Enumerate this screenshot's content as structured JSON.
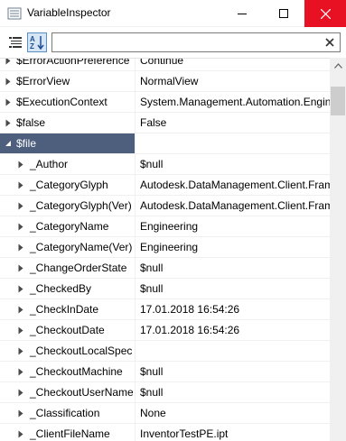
{
  "window": {
    "title": "VariableInspector"
  },
  "toolbar": {
    "categorized_icon": "categorized-icon",
    "alphabetical_icon": "alphabetical-sort-icon",
    "search_value": "",
    "search_placeholder": ""
  },
  "grid": {
    "rows": [
      {
        "name": "$ErrorActionPreference",
        "value": "Continue",
        "level": 0,
        "expanded": false,
        "selected": false
      },
      {
        "name": "$ErrorView",
        "value": "NormalView",
        "level": 0,
        "expanded": false,
        "selected": false
      },
      {
        "name": "$ExecutionContext",
        "value": "System.Management.Automation.EngineIntrinsics",
        "level": 0,
        "expanded": false,
        "selected": false
      },
      {
        "name": "$false",
        "value": "False",
        "level": 0,
        "expanded": false,
        "selected": false
      },
      {
        "name": "$file",
        "value": "",
        "level": 0,
        "expanded": true,
        "selected": true
      },
      {
        "name": "_Author",
        "value": "$null",
        "level": 1,
        "expanded": false,
        "selected": false
      },
      {
        "name": "_CategoryGlyph",
        "value": "Autodesk.DataManagement.Client.Framework",
        "level": 1,
        "expanded": false,
        "selected": false
      },
      {
        "name": "_CategoryGlyph(Ver)",
        "value": "Autodesk.DataManagement.Client.Framework",
        "level": 1,
        "expanded": false,
        "selected": false
      },
      {
        "name": "_CategoryName",
        "value": "Engineering",
        "level": 1,
        "expanded": false,
        "selected": false
      },
      {
        "name": "_CategoryName(Ver)",
        "value": "Engineering",
        "level": 1,
        "expanded": false,
        "selected": false
      },
      {
        "name": "_ChangeOrderState",
        "value": "$null",
        "level": 1,
        "expanded": false,
        "selected": false
      },
      {
        "name": "_CheckedBy",
        "value": "$null",
        "level": 1,
        "expanded": false,
        "selected": false
      },
      {
        "name": "_CheckInDate",
        "value": "17.01.2018 16:54:26",
        "level": 1,
        "expanded": false,
        "selected": false
      },
      {
        "name": "_CheckoutDate",
        "value": "17.01.2018 16:54:26",
        "level": 1,
        "expanded": false,
        "selected": false
      },
      {
        "name": "_CheckoutLocalSpec",
        "value": "",
        "level": 1,
        "expanded": false,
        "selected": false
      },
      {
        "name": "_CheckoutMachine",
        "value": "$null",
        "level": 1,
        "expanded": false,
        "selected": false
      },
      {
        "name": "_CheckoutUserName",
        "value": "$null",
        "level": 1,
        "expanded": false,
        "selected": false
      },
      {
        "name": "_Classification",
        "value": "None",
        "level": 1,
        "expanded": false,
        "selected": false
      },
      {
        "name": "_ClientFileName",
        "value": "InventorTestPE.ipt",
        "level": 1,
        "expanded": false,
        "selected": false
      }
    ]
  },
  "colors": {
    "selected_row": "#4e5f7e",
    "close_button": "#e81123",
    "active_toggle": "#d7e6f5"
  }
}
